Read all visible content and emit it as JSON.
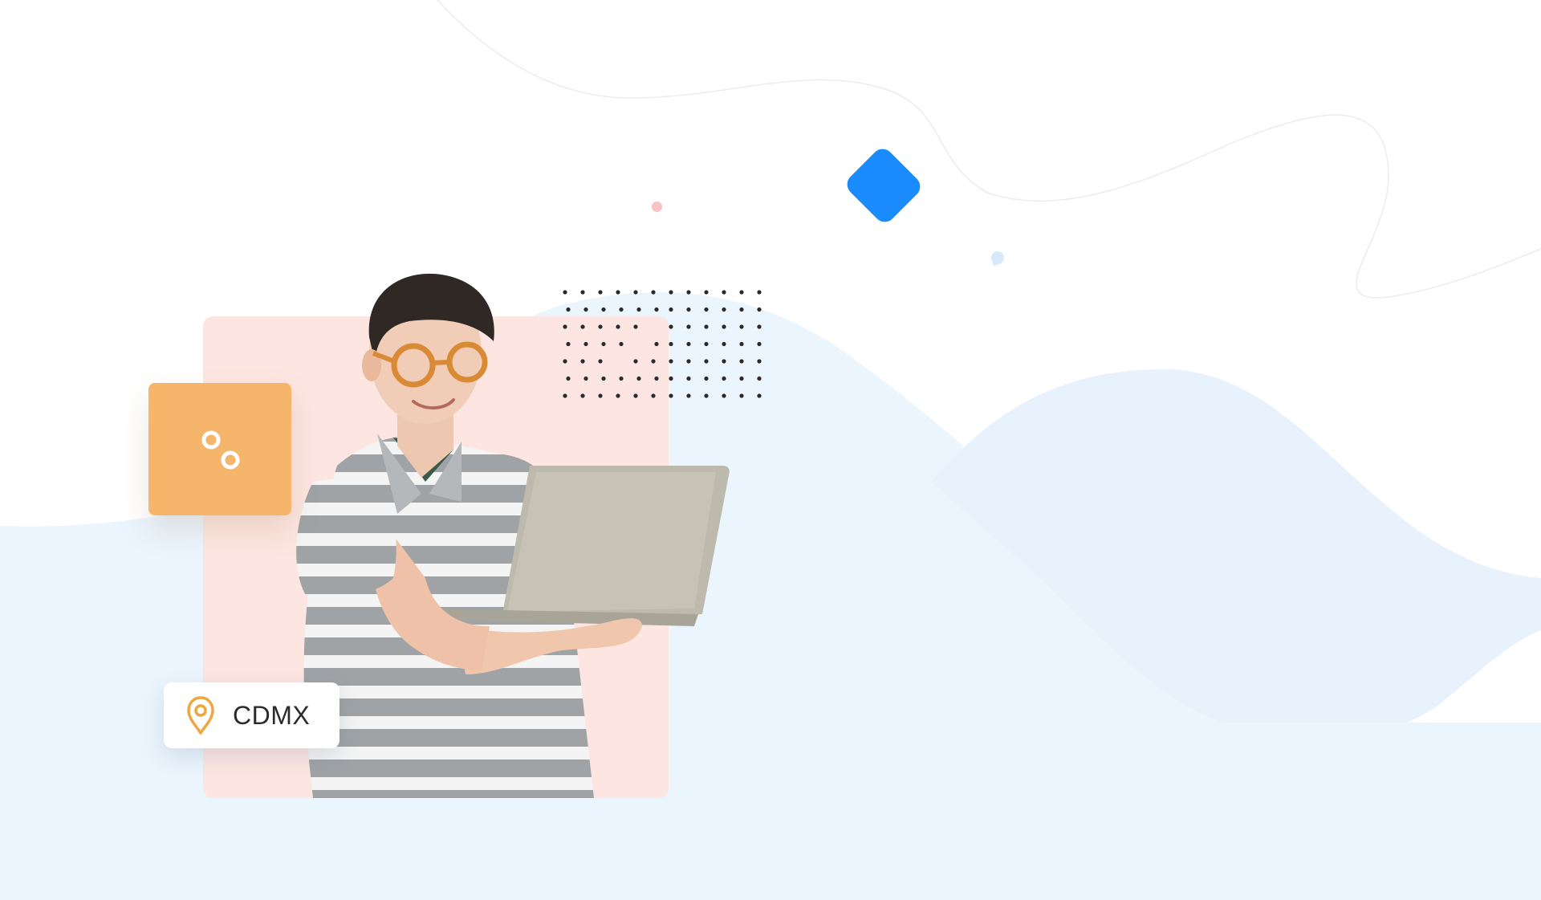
{
  "location_chip": {
    "label": "CDMX",
    "icon": "map-pin-icon"
  },
  "feature_card": {
    "icon": "connection-nodes-icon"
  },
  "colors": {
    "background": "#ffffff",
    "wave_light_blue": "#ebf5fe",
    "panel_pink": "#fde5e1",
    "card_orange": "#f5b56a",
    "accent_blue": "#1a8cff",
    "pin_orange": "#f0a640"
  }
}
